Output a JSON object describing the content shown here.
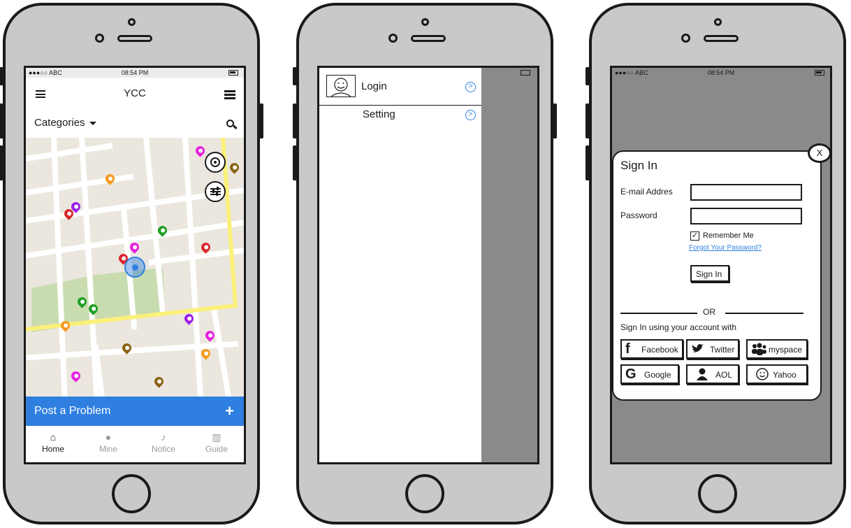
{
  "phone1": {
    "status": {
      "carrier": "●●●○○ ABC",
      "time": "08:54 PM"
    },
    "header": {
      "title": "YCC"
    },
    "categories_label": "Categories",
    "post_problem_label": "Post a Problem",
    "post_problem_icon": "plus-icon",
    "tabs": [
      {
        "label": "Home",
        "icon": "home-icon",
        "active": true
      },
      {
        "label": "Mine",
        "icon": "user-icon",
        "active": false
      },
      {
        "label": "Notice",
        "icon": "bell-icon",
        "active": false
      },
      {
        "label": "Guide",
        "icon": "bank-icon",
        "active": false
      }
    ],
    "map_colors": {
      "road_major": "#fbf07a",
      "park": "#c9dcb0",
      "user_location": "#2f7fe0"
    }
  },
  "phone2": {
    "menu_items": [
      {
        "label": "Login",
        "icon": "avatar-icon"
      },
      {
        "label": "Setting",
        "icon": "chevron-right-icon"
      }
    ]
  },
  "phone3": {
    "status": {
      "carrier": "●●●○○ ABC",
      "time": "08:54 PM"
    },
    "signin": {
      "title": "Sign In",
      "close_label": "X",
      "email_label": "E-mail Addres",
      "password_label": "Password",
      "remember_label": "Remember Me",
      "forgot_label": "Forgot Your Password?",
      "signin_button": "Sign In",
      "or_label": "OR",
      "social_heading": "Sign In using your account with",
      "providers": [
        "Facebook",
        "Twitter",
        "myspace",
        "Google",
        "AOL",
        "Yahoo"
      ]
    }
  },
  "colors": {
    "accent": "#2f7fe0",
    "frame": "#c9c9c9",
    "overlay": "#8a8a8a"
  }
}
